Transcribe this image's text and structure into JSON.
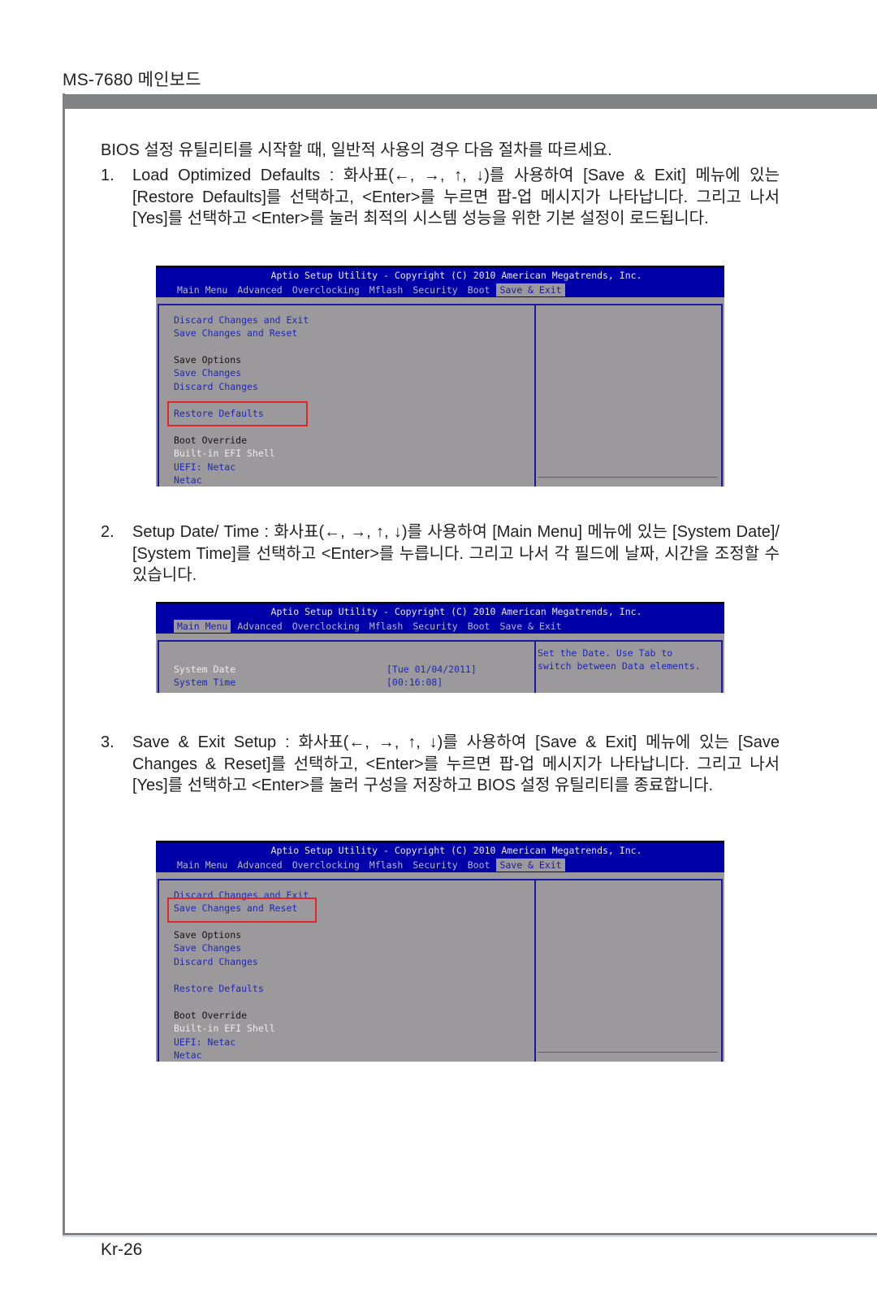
{
  "header": {
    "model_title": "MS-7680 메인보드"
  },
  "intro": "BIOS 설정 유틸리티를 시작할 때, 일반적 사용의 경우 다음 절차를 따르세요.",
  "steps": [
    {
      "number": "1.",
      "text": "Load Optimized Defaults : 화사표(←, →, ↑, ↓)를 사용하여 [Save & Exit] 메뉴에 있는 [Restore Defaults]를 선택하고, <Enter>를 누르면 팝-업 메시지가 나타납니다. 그리고 나서 [Yes]를 선택하고 <Enter>를 눌러 최적의 시스템 성능을 위한 기본 설정이 로드됩니다."
    },
    {
      "number": "2.",
      "text": "Setup Date/ Time : 화사표(←, →, ↑, ↓)를 사용하여 [Main Menu] 메뉴에 있는 [System Date]/ [System Time]를 선택하고 <Enter>를 누릅니다. 그리고 나서 각 필드에 날짜, 시간을 조정할 수 있습니다."
    },
    {
      "number": "3.",
      "text": "Save & Exit Setup :  화사표(←, →, ↑, ↓)를 사용하여 [Save & Exit] 메뉴에 있는 [Save Changes & Reset]를 선택하고, <Enter>를 누르면 팝-업 메시지가 나타납니다. 그리고 나서 [Yes]를 선택하고 <Enter>를 눌러 구성을 저장하고 BIOS 설정 유틸리티를 종료합니다."
    }
  ],
  "bios": {
    "title": "Aptio Setup Utility - Copyright (C) 2010 American Megatrends, Inc.",
    "tabs": [
      "Main Menu",
      "Advanced",
      "Overclocking",
      "Mflash",
      "Security",
      "Boot",
      "Save & Exit"
    ],
    "save_exit_items": [
      {
        "label": "Discard Changes and Exit",
        "color": "blue"
      },
      {
        "label": "Save Changes and Reset",
        "color": "blue"
      },
      {
        "label": "Save Options",
        "color": "black"
      },
      {
        "label": "Save Changes",
        "color": "blue"
      },
      {
        "label": "Discard Changes",
        "color": "blue"
      },
      {
        "label": "Restore Defaults",
        "color": "blue"
      },
      {
        "label": "Boot Override",
        "color": "black"
      },
      {
        "label": "Built-in EFI Shell",
        "color": "white"
      },
      {
        "label": "UEFI: Netac",
        "color": "blue"
      },
      {
        "label": "Netac",
        "color": "blue"
      }
    ],
    "main_menu": {
      "system_date_label": "System Date",
      "system_date_value": "[Tue 01/04/2011]",
      "system_time_label": "System Time",
      "system_time_value": "[00:16:08]",
      "help_text": "Set the Date. Use Tab to\nswitch between Data elements."
    },
    "colors": {
      "header_blue": "#0000a8",
      "panel_gray": "#9b999b",
      "item_blue": "#1e28b4",
      "highlight_red": "#e0262c"
    }
  },
  "screens": [
    {
      "active_tab": "Save & Exit",
      "highlighted_item": "Restore Defaults"
    },
    {
      "active_tab": "Main Menu",
      "highlighted_item": ""
    },
    {
      "active_tab": "Save & Exit",
      "highlighted_item": "Save Changes and Reset"
    }
  ],
  "footer": {
    "page_number": "Kr-26"
  }
}
